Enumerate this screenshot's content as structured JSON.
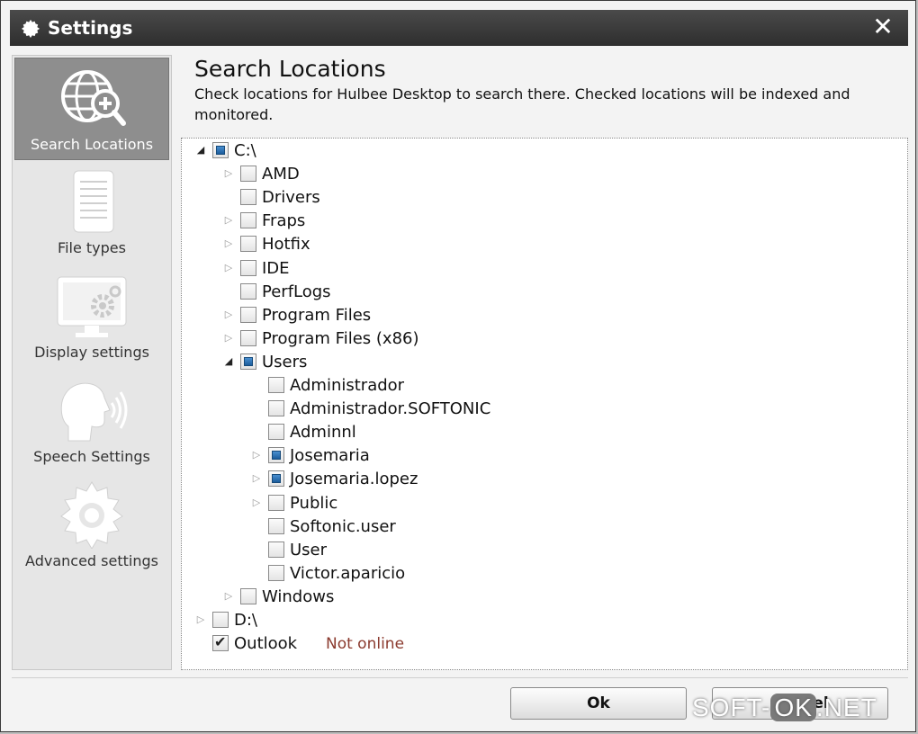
{
  "window": {
    "title": "Settings",
    "close_glyph": "✕"
  },
  "sidebar": {
    "items": [
      {
        "label": "Search Locations",
        "icon": "globe-search-icon",
        "active": true
      },
      {
        "label": "File types",
        "icon": "document-icon",
        "active": false
      },
      {
        "label": "Display settings",
        "icon": "monitor-gear-icon",
        "active": false
      },
      {
        "label": "Speech Settings",
        "icon": "speaking-head-icon",
        "active": false
      },
      {
        "label": "Advanced settings",
        "icon": "gear-icon",
        "active": false
      }
    ]
  },
  "main": {
    "title": "Search Locations",
    "description": "Check locations for Hulbee Desktop to search there. Checked locations will be indexed and monitored."
  },
  "tree": {
    "nodes": [
      {
        "label": "C:\\",
        "level": 0,
        "arrow": "expanded",
        "state": "partial"
      },
      {
        "label": "AMD",
        "level": 1,
        "arrow": "collapsed",
        "state": "unchecked"
      },
      {
        "label": "Drivers",
        "level": 1,
        "arrow": "none",
        "state": "unchecked"
      },
      {
        "label": "Fraps",
        "level": 1,
        "arrow": "collapsed",
        "state": "unchecked"
      },
      {
        "label": "Hotfix",
        "level": 1,
        "arrow": "collapsed",
        "state": "unchecked"
      },
      {
        "label": "IDE",
        "level": 1,
        "arrow": "collapsed",
        "state": "unchecked"
      },
      {
        "label": "PerfLogs",
        "level": 1,
        "arrow": "none",
        "state": "unchecked"
      },
      {
        "label": "Program Files",
        "level": 1,
        "arrow": "collapsed",
        "state": "unchecked"
      },
      {
        "label": "Program Files (x86)",
        "level": 1,
        "arrow": "collapsed",
        "state": "unchecked"
      },
      {
        "label": "Users",
        "level": 1,
        "arrow": "expanded",
        "state": "partial"
      },
      {
        "label": "Administrador",
        "level": 2,
        "arrow": "none",
        "state": "unchecked"
      },
      {
        "label": "Administrador.SOFTONIC",
        "level": 2,
        "arrow": "none",
        "state": "unchecked"
      },
      {
        "label": "Adminnl",
        "level": 2,
        "arrow": "none",
        "state": "unchecked"
      },
      {
        "label": "Josemaria",
        "level": 2,
        "arrow": "collapsed",
        "state": "partial"
      },
      {
        "label": "Josemaria.lopez",
        "level": 2,
        "arrow": "collapsed",
        "state": "partial"
      },
      {
        "label": "Public",
        "level": 2,
        "arrow": "collapsed",
        "state": "unchecked"
      },
      {
        "label": "Softonic.user",
        "level": 2,
        "arrow": "none",
        "state": "unchecked"
      },
      {
        "label": "User",
        "level": 2,
        "arrow": "none",
        "state": "unchecked"
      },
      {
        "label": "Victor.aparicio",
        "level": 2,
        "arrow": "none",
        "state": "unchecked"
      },
      {
        "label": "Windows",
        "level": 1,
        "arrow": "collapsed",
        "state": "unchecked"
      },
      {
        "label": "D:\\",
        "level": 0,
        "arrow": "collapsed",
        "state": "unchecked"
      },
      {
        "label": "Outlook",
        "level": 0,
        "arrow": "none",
        "state": "checked",
        "status": "Not online"
      }
    ]
  },
  "buttons": {
    "ok_label": "Ok",
    "cancel_label": "Cancel"
  },
  "watermark": {
    "left": "SOFT-",
    "box": "OK",
    "right": ".NET"
  },
  "colors": {
    "title_bar": "#3a3a3a",
    "active_nav": "#8e8e8e",
    "checked_blue": "#2a6fb5",
    "status_text": "#8b3a2e"
  }
}
